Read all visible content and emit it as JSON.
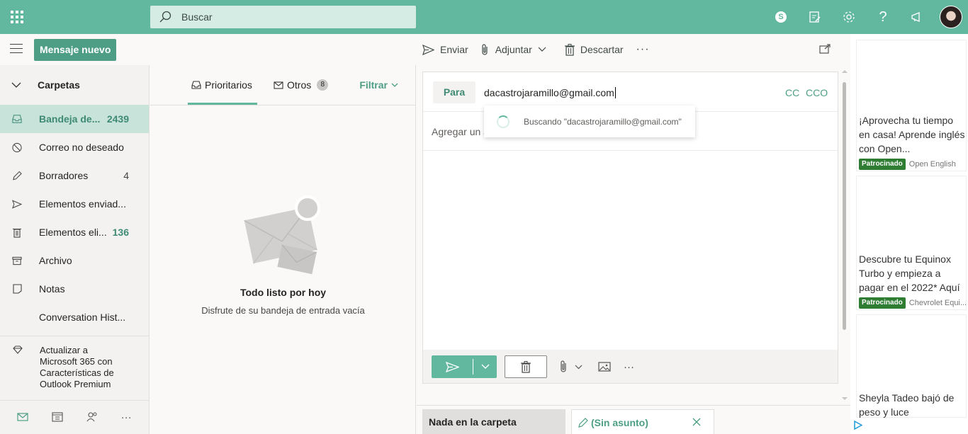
{
  "colors": {
    "accent": "#62b89e",
    "accent_dark": "#4d9e85",
    "sponsor_green": "#2e7d32"
  },
  "topbar": {
    "search_placeholder": "Buscar",
    "icons": [
      "app-launcher-icon",
      "skype-icon",
      "my-day-icon",
      "settings-icon",
      "help-icon",
      "whats-new-icon",
      "avatar"
    ]
  },
  "toolbar": {
    "new_message": "Mensaje nuevo",
    "send": "Enviar",
    "attach": "Adjuntar",
    "discard": "Descartar",
    "more": "···"
  },
  "folders": {
    "header": "Carpetas",
    "items": [
      {
        "label": "Bandeja de...",
        "count": "2439",
        "icon": "inbox-icon"
      },
      {
        "label": "Correo no deseado",
        "count": "",
        "icon": "junk-icon"
      },
      {
        "label": "Borradores",
        "count": "4",
        "icon": "pencil-icon"
      },
      {
        "label": "Elementos enviad...",
        "count": "",
        "icon": "send-icon"
      },
      {
        "label": "Elementos eli...",
        "count": "136",
        "icon": "trash-icon"
      },
      {
        "label": "Archivo",
        "count": "",
        "icon": "archive-icon"
      },
      {
        "label": "Notas",
        "count": "",
        "icon": "note-icon"
      },
      {
        "label": "Conversation Hist...",
        "count": "",
        "icon": ""
      }
    ],
    "upgrade": "Actualizar a Microsoft 365 con Características de Outlook Premium",
    "more": "···"
  },
  "message_list": {
    "tab_focused": "Prioritarios",
    "tab_other": "Otros",
    "other_count": "8",
    "filter": "Filtrar",
    "empty_title": "Todo listo por hoy",
    "empty_subtitle": "Disfrute de su bandeja de entrada vacía"
  },
  "compose": {
    "to_label": "Para",
    "to_value": "dacastrojaramillo@gmail.com",
    "cc": "CC",
    "bcc": "CCO",
    "subject_placeholder": "Agregar un asunto",
    "suggestion": "Buscando \"dacastrojaramillo@gmail.com\"",
    "more": "···"
  },
  "bottom_tabs": {
    "folder_tab": "Nada en la carpeta",
    "draft_tab": "(Sin asunto)"
  },
  "ads": [
    {
      "text": "¡Aprovecha tu tiempo en casa! Aprende inglés con Open...",
      "tag": "Patrocinado",
      "brand": "Open English"
    },
    {
      "text": "Descubre tu Equinox Turbo y empieza a pagar en el 2022* Aquí",
      "tag": "Patrocinado",
      "brand": "Chevrolet Equi..."
    },
    {
      "text": "Sheyla Tadeo bajó de peso y luce",
      "tag": "",
      "brand": ""
    }
  ]
}
